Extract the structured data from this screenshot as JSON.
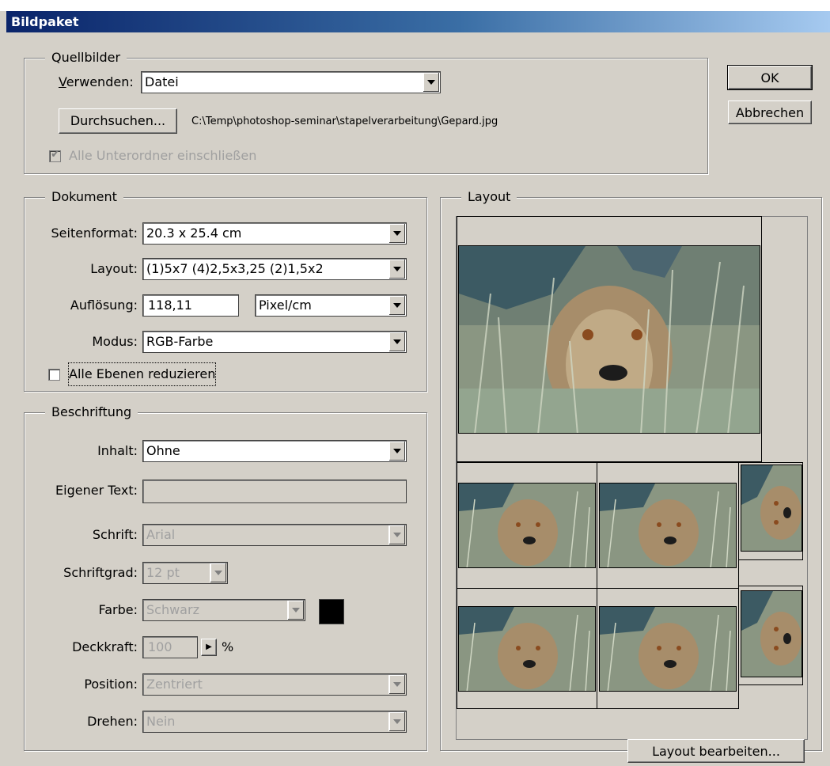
{
  "window": {
    "title": "Bildpaket"
  },
  "buttons": {
    "ok": "OK",
    "cancel": "Abbrechen",
    "layout_edit": "Layout bearbeiten..."
  },
  "source": {
    "legend": "Quellbilder",
    "use_label": "Verwenden:",
    "use_value": "Datei",
    "browse": "Durchsuchen...",
    "path": "C:\\Temp\\photoshop-seminar\\stapelverarbeitung\\Gepard.jpg",
    "include_subfolders": "Alle Unterordner einschließen",
    "include_subfolders_checked": true
  },
  "document": {
    "legend": "Dokument",
    "page_size_label": "Seitenformat:",
    "page_size_value": "20.3 x 25.4 cm",
    "layout_label": "Layout:",
    "layout_value": "(1)5x7 (4)2,5x3,25 (2)1,5x2",
    "resolution_label": "Auflösung:",
    "resolution_value": "118,11",
    "resolution_unit": "Pixel/cm",
    "mode_label": "Modus:",
    "mode_value": "RGB-Farbe",
    "flatten_label": "Alle Ebenen reduzieren",
    "flatten_checked": false
  },
  "caption": {
    "legend": "Beschriftung",
    "content_label": "Inhalt:",
    "content_value": "Ohne",
    "custom_text_label": "Eigener Text:",
    "custom_text_value": "",
    "font_label": "Schrift:",
    "font_value": "Arial",
    "font_size_label": "Schriftgrad:",
    "font_size_value": "12 pt",
    "color_label": "Farbe:",
    "color_value": "Schwarz",
    "color_swatch": "#000000",
    "opacity_label": "Deckkraft:",
    "opacity_value": "100",
    "opacity_unit": "%",
    "position_label": "Position:",
    "position_value": "Zentriert",
    "rotate_label": "Drehen:",
    "rotate_value": "Nein"
  },
  "layout_preview": {
    "legend": "Layout"
  }
}
